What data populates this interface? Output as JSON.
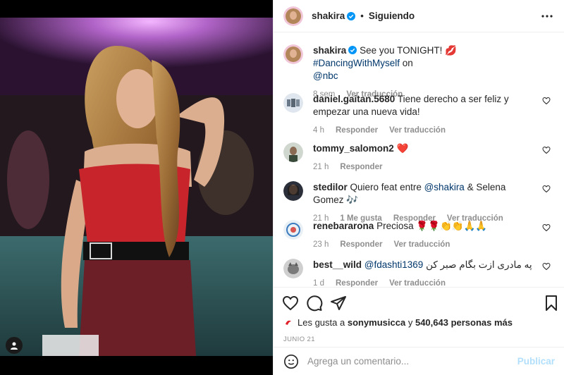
{
  "post": {
    "username": "shakira",
    "follow_status": "Siguiendo",
    "more_icon": "more-horizontal-icon"
  },
  "caption": {
    "username": "shakira",
    "text_before": "See you TONIGHT! 💋 ",
    "hashtag": "#DancingWithMyself",
    "text_mid": " on",
    "mention": "@nbc",
    "age": "8 sem",
    "translate": "Ver traducción"
  },
  "comments": [
    {
      "username": "daniel.gaitan.5680",
      "text": "Tiene derecho a ser feliz y empezar una nueva vida!",
      "age": "4 h",
      "likes": "",
      "reply": "Responder",
      "translate": "Ver traducción"
    },
    {
      "username": "tommy_salomon2",
      "text": "❤️",
      "age": "21 h",
      "likes": "",
      "reply": "Responder",
      "translate": ""
    },
    {
      "username": "stedilor",
      "text_before": "Quiero feat entre ",
      "mention": "@shakira",
      "text_after": " & Selena Gomez 🎶",
      "age": "21 h",
      "likes": "1 Me gusta",
      "reply": "Responder",
      "translate": "Ver traducción"
    },
    {
      "username": "renebararona",
      "text": "Preciosa 🌹🌹👏👏🙏🙏",
      "age": "23 h",
      "likes": "",
      "reply": "Responder",
      "translate": "Ver traducción"
    },
    {
      "username": "best__wild",
      "mention": "@fdashti1369",
      "text_after": " په مادری ازت بگام صبر کن",
      "age": "1 d",
      "likes": "",
      "reply": "Responder",
      "translate": "Ver traducción"
    }
  ],
  "likes": {
    "prefix": "Les gusta a ",
    "liker": "sonymusicca",
    "middle": " y ",
    "count": "540,643 personas más"
  },
  "date": "JUNIO 21",
  "composer": {
    "placeholder": "Agrega un comentario...",
    "publish": "Publicar"
  },
  "colors": {
    "link": "#00376b",
    "verified": "#0095f6",
    "publish_disabled": "#b2dffc",
    "muted": "#8e8e8e"
  }
}
